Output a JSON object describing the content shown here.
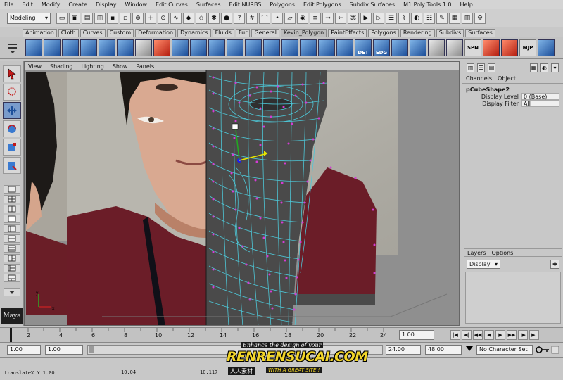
{
  "menubar": {
    "items": [
      "File",
      "Edit",
      "Modify",
      "Create",
      "Display",
      "Window",
      "Edit Curves",
      "Surfaces",
      "Edit NURBS",
      "Polygons",
      "Edit Polygons",
      "Subdiv Surfaces",
      "M1 Poly Tools 1.0",
      "Help"
    ]
  },
  "statusline": {
    "mode": "Modeling"
  },
  "shelf": {
    "tabs": [
      "Animation",
      "Cloth",
      "Curves",
      "Custom",
      "Deformation",
      "Dynamics",
      "Fluids",
      "Fur",
      "General",
      "Kevin_Polygon",
      "PaintEffects",
      "Polygons",
      "Rendering",
      "Subdivs",
      "Surfaces"
    ],
    "active_tab": "Kevin_Polygon",
    "labeled_buttons": [
      "DET",
      "EDG",
      "SPN",
      "MJP"
    ]
  },
  "viewport": {
    "menu": [
      "View",
      "Shading",
      "Lighting",
      "Show",
      "Panels"
    ],
    "colors": {
      "wire": "#4ec6d6",
      "verts": "#d43cd4",
      "mesh": "#4a4a4a",
      "backdrop": "#8f8f8f"
    }
  },
  "channel_box": {
    "menu": [
      "Channels",
      "Object"
    ],
    "node": "pCubeShape2",
    "rows": [
      {
        "label": "Display Level",
        "value": "0 (Base)"
      },
      {
        "label": "Display Filter",
        "value": "All"
      }
    ]
  },
  "layers": {
    "menu": [
      "Layers",
      "Options"
    ],
    "select": "Display"
  },
  "timeline": {
    "ticks": [
      "2",
      "4",
      "6",
      "8",
      "10",
      "12",
      "14",
      "16",
      "18",
      "20",
      "22",
      "24"
    ],
    "current_frame": "1.00"
  },
  "range": {
    "start": "1.00",
    "playback_start": "1.00",
    "playback_end": "24.00",
    "end": "48.00",
    "character_set": "No Character Set"
  },
  "command_line": {
    "text": "translateX  Y  1.00",
    "value_a": "10.04",
    "value_b": "10.117"
  },
  "watermark": {
    "tagline": "Enhance the design of your",
    "main": "RENRENSUCAI.COM",
    "sub": "人人素材",
    "sub2": "WITH A GREAT SITE !"
  },
  "logo": {
    "text": "Maya"
  }
}
